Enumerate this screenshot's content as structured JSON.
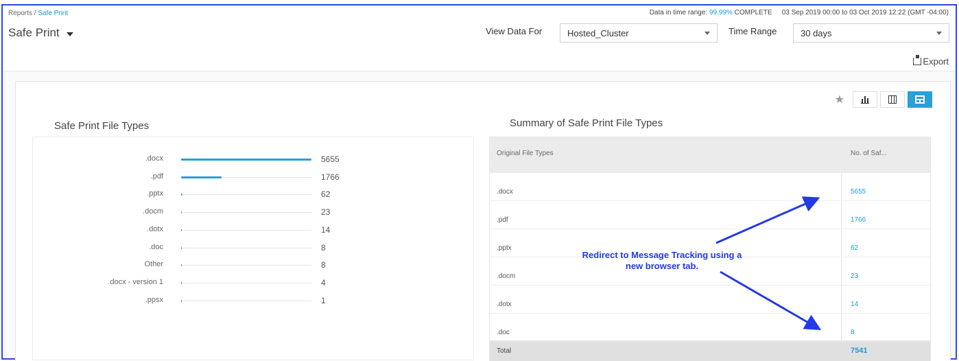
{
  "breadcrumb": {
    "parent": "Reports",
    "separator": " / ",
    "current": "Safe Print"
  },
  "page_title": "Safe Print",
  "range_info": {
    "prefix": "Data in time range: ",
    "percent": "99.99%",
    "suffix": " COMPLETE",
    "dates": "03 Sep 2019 00:00 to 03 Oct 2019 12:22 (GMT -04:00)"
  },
  "filters": {
    "view_label": "View Data For",
    "view_value": "Hosted_Cluster",
    "time_label": "Time Range",
    "time_value": "30 days"
  },
  "export_label": "Export",
  "chart_title": "Safe Print File Types",
  "chart_data": {
    "type": "bar",
    "orientation": "horizontal",
    "title": "Safe Print File Types",
    "categories": [
      ".docx",
      ".pdf",
      ".pptx",
      ".docm",
      ".dotx",
      ".doc",
      "Other",
      ".docx - version 1",
      ".ppsx"
    ],
    "values": [
      5655,
      1766,
      62,
      23,
      14,
      8,
      8,
      4,
      1
    ],
    "xlim": [
      0,
      5655
    ],
    "color": "#2a9fd8"
  },
  "summary": {
    "title": "Summary of Safe Print File Types",
    "headers": [
      "Original File Types",
      "No. of Saf..."
    ],
    "rows": [
      {
        "type": ".docx",
        "count": "5655"
      },
      {
        "type": ".pdf",
        "count": "1766"
      },
      {
        "type": ".pptx",
        "count": "62"
      },
      {
        "type": ".docm",
        "count": "23"
      },
      {
        "type": ".dotx",
        "count": "14"
      },
      {
        "type": ".doc",
        "count": "8"
      }
    ],
    "total_label": "Total",
    "total_value": "7541"
  },
  "annotation": {
    "line1": "Redirect to Message Tracking using a",
    "line2": "new browser tab."
  },
  "colors": {
    "accent": "#2a9fd8",
    "link": "#1f9ad8",
    "annotation": "#2339e6",
    "frame": "#2b47f0"
  }
}
